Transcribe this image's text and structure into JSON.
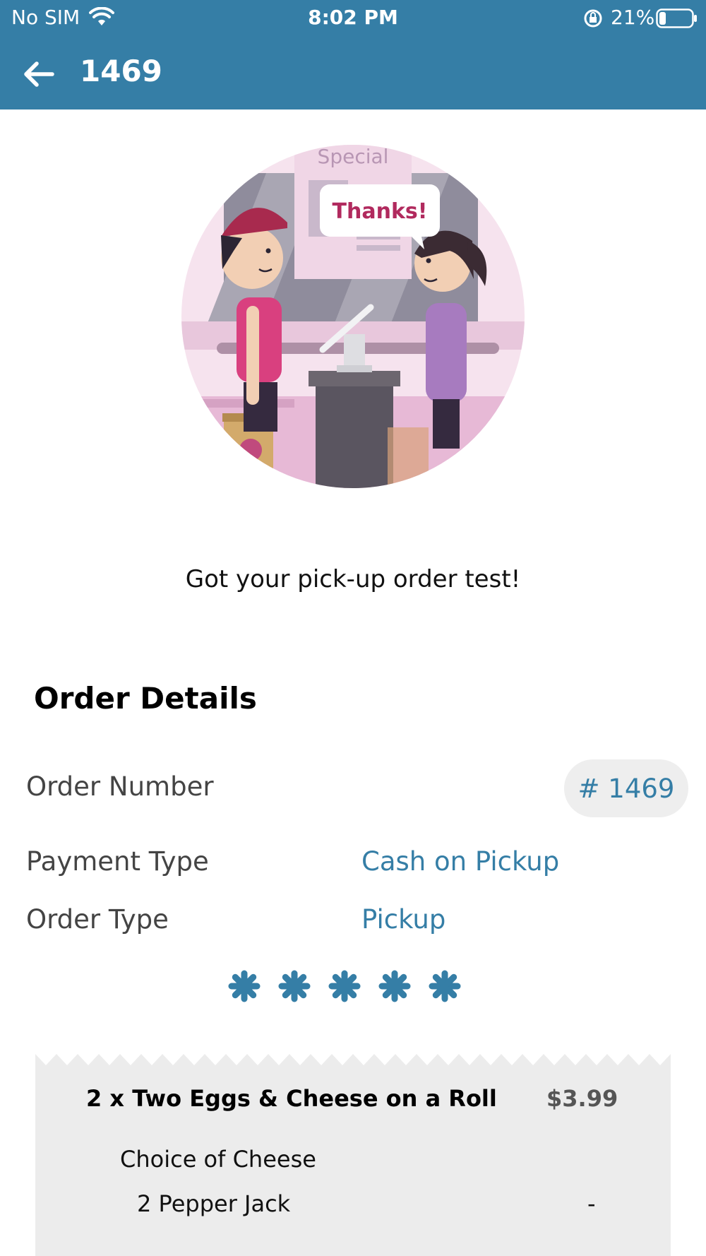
{
  "status_bar": {
    "carrier": "No SIM",
    "time": "8:02 PM",
    "battery_percent": "21%",
    "battery_level": 0.21,
    "icons": [
      "wifi-icon",
      "orientation-lock-icon",
      "battery-icon"
    ]
  },
  "app_bar": {
    "title": "1469",
    "back_icon": "arrow-left-icon"
  },
  "hero": {
    "speech_bubble": "Thanks!",
    "sign_text": "Special"
  },
  "message": "Got your pick-up order test!",
  "order_details": {
    "title": "Order Details",
    "order_number_label": "Order Number",
    "order_number_value": "# 1469",
    "payment_type_label": "Payment Type",
    "payment_type_value": "Cash on Pickup",
    "order_type_label": "Order Type",
    "order_type_value": "Pickup"
  },
  "stars": {
    "count": 5,
    "icon": "asterisk-icon"
  },
  "receipt": {
    "items": [
      {
        "name": "2 x Two Eggs & Cheese on a Roll",
        "price": "$3.99",
        "modifier_group": "Choice of Cheese",
        "modifier_option": "2 Pepper Jack",
        "modifier_price": "-"
      }
    ]
  },
  "colors": {
    "primary": "#357ea6",
    "pill_bg": "#eeeeee",
    "receipt_bg": "#ececec"
  }
}
